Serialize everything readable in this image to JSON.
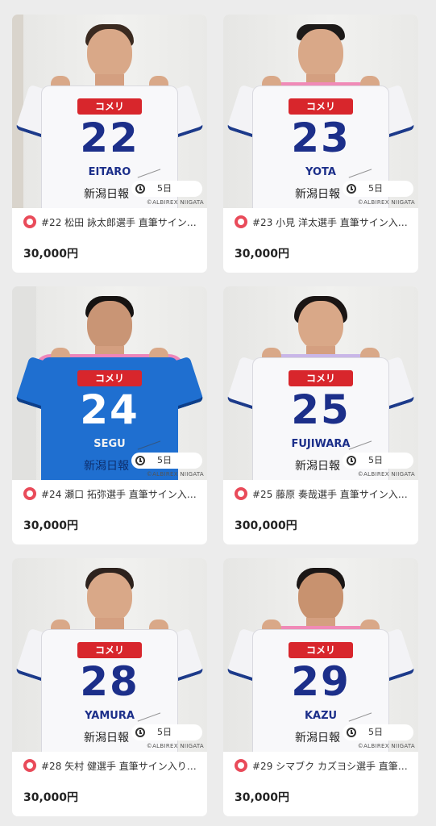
{
  "items": [
    {
      "number": "22",
      "jersey_name": "EITARO",
      "title": "#22 松田 詠太郎選手 直筆サイン入…",
      "price": "30,000円",
      "time_left": "5日",
      "jersey_color": "white",
      "hair_color": "#3a2a20"
    },
    {
      "number": "23",
      "jersey_name": "YOTA",
      "title": "#23 小見 洋太選手 直筆サイン入…",
      "price": "30,000円",
      "time_left": "5日",
      "jersey_color": "white",
      "hair_color": "#1d1a19"
    },
    {
      "number": "24",
      "jersey_name": "SEGU",
      "title": "#24 瀬口 拓弥選手 直筆サイン入…",
      "price": "30,000円",
      "time_left": "5日",
      "jersey_color": "blue",
      "hair_color": "#161312"
    },
    {
      "number": "25",
      "jersey_name": "FUJIWARA",
      "title": "#25 藤原 奏哉選手 直筆サイン入…",
      "price": "300,000円",
      "time_left": "5日",
      "jersey_color": "white",
      "hair_color": "#1a1514"
    },
    {
      "number": "28",
      "jersey_name": "YAMURA",
      "title": "#28 矢村 健選手 直筆サイン入り…",
      "price": "30,000円",
      "time_left": "5日",
      "jersey_color": "white",
      "hair_color": "#2d221d"
    },
    {
      "number": "29",
      "jersey_name": "KAZU",
      "title": "#29 シマブク カズヨシ選手 直筆…",
      "price": "30,000円",
      "time_left": "5日",
      "jersey_color": "white",
      "hair_color": "#1b1716"
    }
  ],
  "common": {
    "sponsor": "コメリ",
    "paper": "新潟日報",
    "copyright": "©ALBIREX NIIGATA"
  }
}
